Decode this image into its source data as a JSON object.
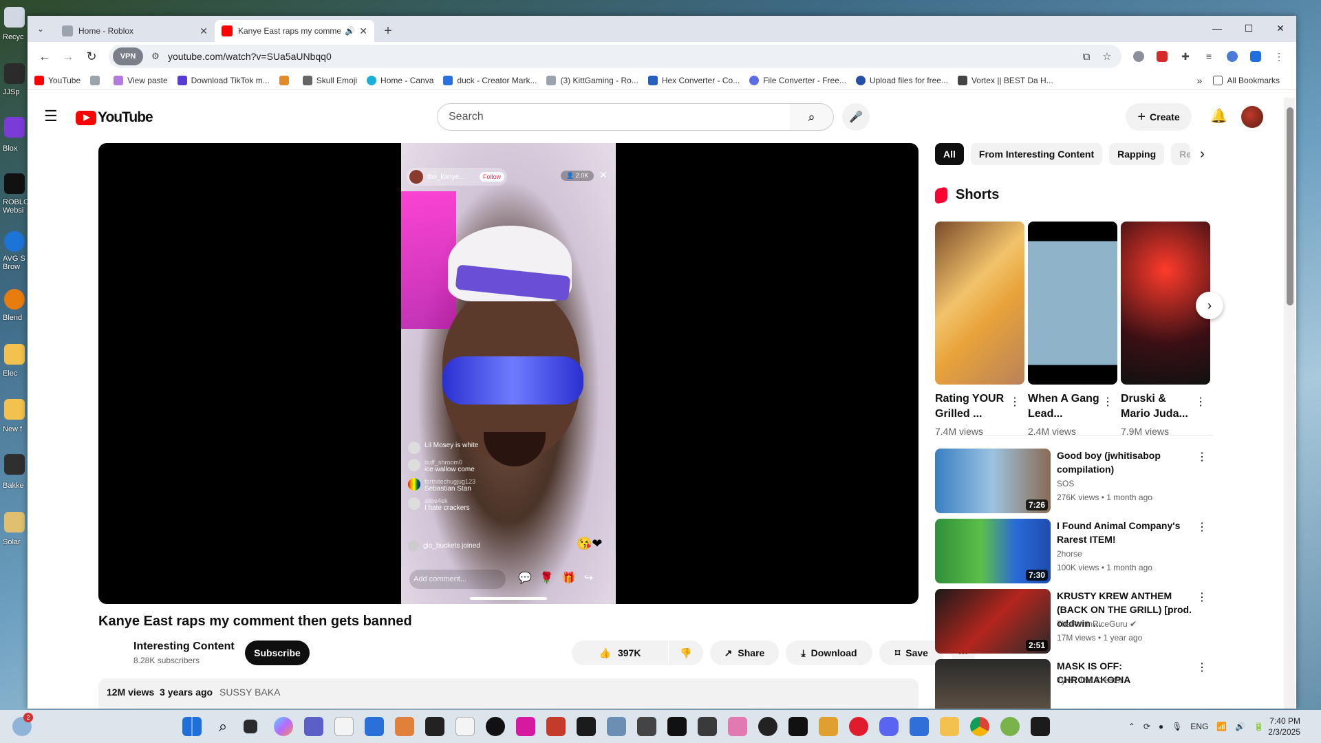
{
  "desktop": {
    "labels": [
      "Recyc",
      "JJSp",
      "Blox",
      "ROBLO Websi",
      "AVG S Brow",
      "Blend",
      "Elec",
      "New f",
      "Bakke",
      "Solar"
    ]
  },
  "browser": {
    "tabs": [
      {
        "title": "Home - Roblox",
        "close": "✕"
      },
      {
        "title": "Kanye East raps my comme",
        "close": "✕"
      }
    ],
    "new_tab": "+",
    "vpn": "VPN",
    "url": "youtube.com/watch?v=SUa5aUNbqq0",
    "bookmarks": [
      "YouTube",
      "View paste",
      "Download TikTok m...",
      "Skull Emoji",
      "Home - Canva",
      "duck - Creator Mark...",
      "(3) KittGaming - Ro...",
      "Hex Converter - Co...",
      "File Converter - Free...",
      "Upload files for free...",
      "Vortex || BEST Da H..."
    ],
    "all_bookmarks": "All Bookmarks"
  },
  "youtube": {
    "logo": "YouTube",
    "search_placeholder": "Search",
    "create": "Create",
    "video": {
      "title": "Kanye East raps my comment then gets banned",
      "channel": "Interesting Content",
      "subscribers": "8.28K subscribers",
      "subscribe": "Subscribe",
      "likes": "397K",
      "share": "Share",
      "download": "Download",
      "save": "Save",
      "views": "12M views",
      "age": "3 years ago",
      "tag": "SUSSY BAKA"
    },
    "overlay": {
      "user": "the_kanye...",
      "follow": "Follow",
      "viewers": "2.0K",
      "comments": [
        {
          "user": "",
          "text": "Lil Mosey is white"
        },
        {
          "user": "buff_shroom0",
          "text": "ice wallow come"
        },
        {
          "user": "fortnitechugjug123",
          "text": "Sebastian Stan"
        },
        {
          "user": "alibe4ek",
          "text": "I hate crackers"
        }
      ],
      "joined": "gio_buckets joined",
      "add_comment": "Add comment..."
    },
    "chips": [
      "All",
      "From Interesting Content",
      "Rapping",
      "Re"
    ],
    "shorts_heading": "Shorts",
    "shorts": [
      {
        "title": "Rating YOUR Grilled ...",
        "views": "7.4M views"
      },
      {
        "title": "When A Gang Lead...",
        "views": "2.4M views"
      },
      {
        "title": "Druski & Mario Juda...",
        "views": "7.9M views"
      }
    ],
    "recommended": [
      {
        "title": "Good boy (jwhitisabop compilation)",
        "channel": "SOS",
        "meta": "276K views • 1 month ago",
        "duration": "7:26"
      },
      {
        "title": "I Found Animal Company's Rarest ITEM!",
        "channel": "2horse",
        "meta": "100K views • 1 month ago",
        "duration": "7:30"
      },
      {
        "title": "KRUSTY KREW ANTHEM (BACK ON THE GRILL) [prod. oddwin ...",
        "channel": "TheRoninRiceGuru ✔",
        "meta": "17M views • 1 year ago",
        "duration": "2:51"
      },
      {
        "title": "MASK IS OFF: CHROMAKOPIA",
        "channel": "Tyler, The Creator",
        "meta": "",
        "duration": ""
      }
    ]
  },
  "taskbar": {
    "notify_badge": "2",
    "lang": "ENG",
    "time": "7:40 PM",
    "date": "2/3/2025"
  },
  "colors": {
    "yt_red": "#ff0000",
    "dark": "#0f0f0f",
    "chip_bg": "#f2f2f2",
    "taskbar": "#dce4ec"
  }
}
